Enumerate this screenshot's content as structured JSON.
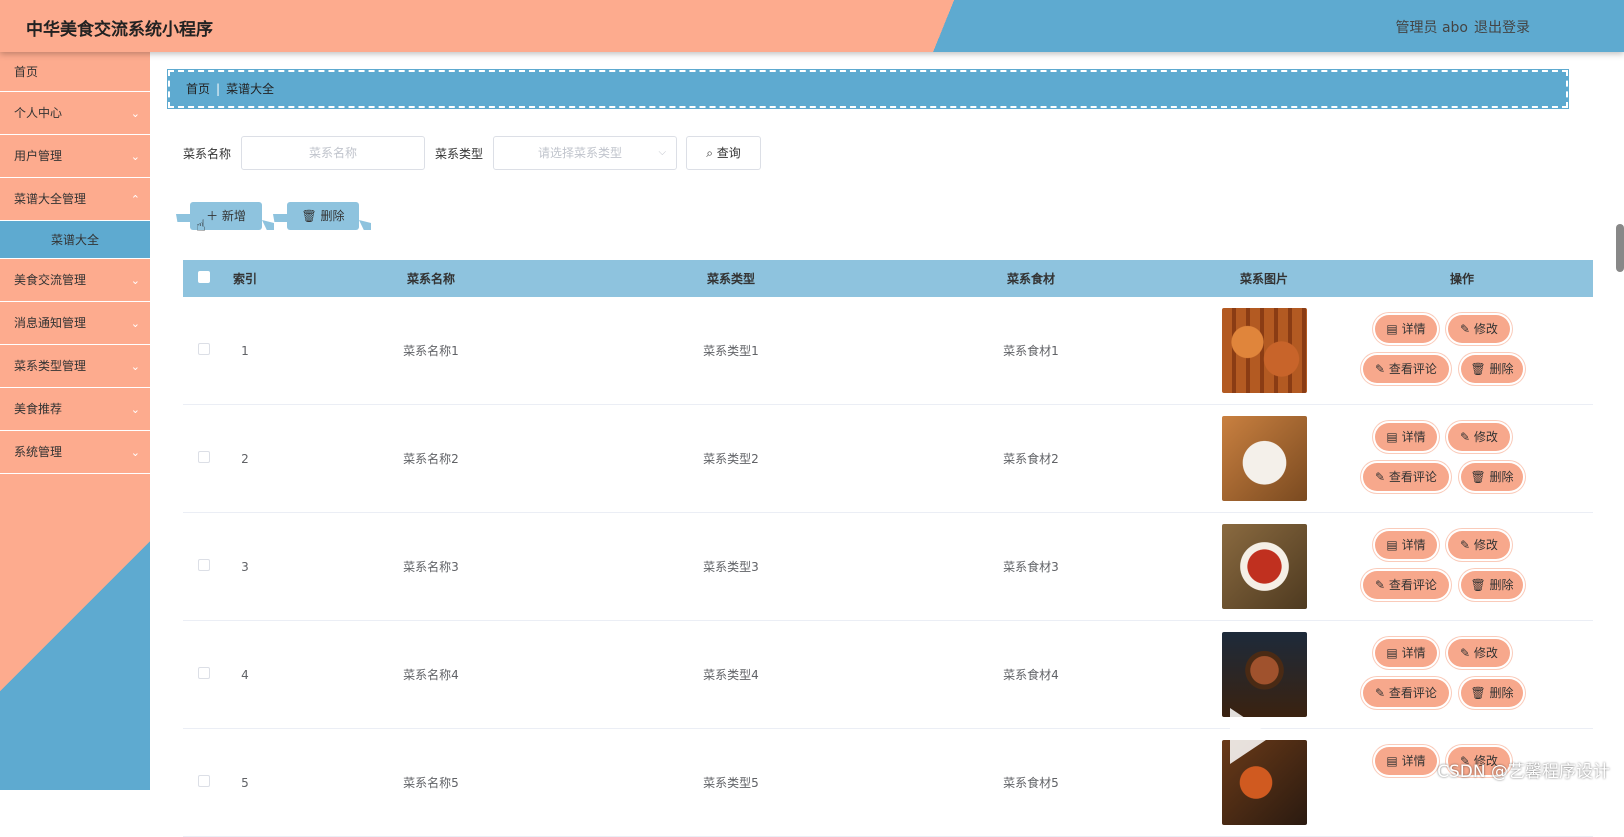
{
  "header": {
    "title": "中华美食交流系统小程序",
    "admin": "管理员 abo",
    "logout": "退出登录"
  },
  "sidebar": {
    "items": [
      {
        "label": "首页"
      },
      {
        "label": "个人中心"
      },
      {
        "label": "用户管理"
      },
      {
        "label": "菜谱大全管理"
      },
      {
        "label": "美食交流管理"
      },
      {
        "label": "消息通知管理"
      },
      {
        "label": "菜系类型管理"
      },
      {
        "label": "美食推荐"
      },
      {
        "label": "系统管理"
      }
    ],
    "active_sub": "菜谱大全"
  },
  "breadcrumb": {
    "home": "首页",
    "current": "菜谱大全"
  },
  "search": {
    "name_label": "菜系名称",
    "name_placeholder": "菜系名称",
    "type_label": "菜系类型",
    "type_placeholder": "请选择菜系类型",
    "query": "查询"
  },
  "actions": {
    "add": "新增",
    "delete": "删除"
  },
  "table": {
    "headers": [
      "索引",
      "菜系名称",
      "菜系类型",
      "菜系食材",
      "菜系图片",
      "操作"
    ],
    "rows": [
      {
        "index": "1",
        "name": "菜系名称1",
        "type": "菜系类型1",
        "ingredient": "菜系食材1"
      },
      {
        "index": "2",
        "name": "菜系名称2",
        "type": "菜系类型2",
        "ingredient": "菜系食材2"
      },
      {
        "index": "3",
        "name": "菜系名称3",
        "type": "菜系类型3",
        "ingredient": "菜系食材3"
      },
      {
        "index": "4",
        "name": "菜系名称4",
        "type": "菜系类型4",
        "ingredient": "菜系食材4"
      },
      {
        "index": "5",
        "name": "菜系名称5",
        "type": "菜系类型5",
        "ingredient": "菜系食材5"
      }
    ],
    "ops": {
      "detail": "详情",
      "edit": "修改",
      "comments": "查看评论",
      "delete": "删除"
    }
  },
  "watermark": "CSDN @艺馨程序设计",
  "colors": {
    "peach": "#fdab8e",
    "blue": "#5eaad0",
    "light_blue": "#8ec3de",
    "op_button": "#f7a88c"
  },
  "icons": [
    "chevron-down-icon",
    "search-icon",
    "plus-icon",
    "trash-icon",
    "document-icon",
    "edit-icon",
    "hand-cursor-icon",
    "play-icon"
  ]
}
